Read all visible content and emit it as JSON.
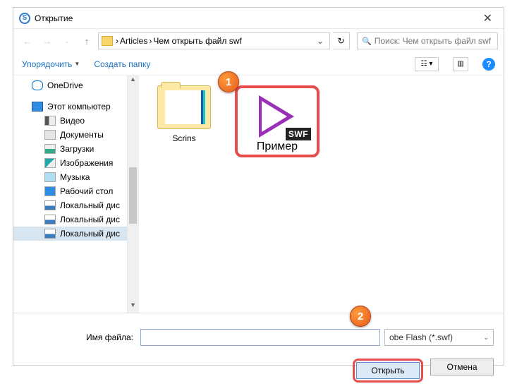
{
  "window": {
    "title": "Открытие",
    "close_glyph": "✕"
  },
  "nav": {
    "back_glyph": "←",
    "fwd_glyph": "→",
    "up_glyph": "↑",
    "crumb1": "Articles",
    "crumb2": "Чем открыть файл swf",
    "crumb_sep": "›",
    "drop_glyph": "⌄",
    "refresh_glyph": "↻",
    "search_placeholder": "Поиск: Чем открыть файл swf"
  },
  "toolbar": {
    "organize": "Упорядочить",
    "newfolder": "Создать папку",
    "help_glyph": "?"
  },
  "tree": {
    "onedrive": "OneDrive",
    "thispc": "Этот компьютер",
    "video": "Видео",
    "docs": "Документы",
    "downloads": "Загрузки",
    "images": "Изображения",
    "music": "Музыка",
    "desktop": "Рабочий стол",
    "disk1": "Локальный дис",
    "disk2": "Локальный дис",
    "disk3": "Локальный дис"
  },
  "files": {
    "folder1": "Scrins",
    "swf_label": "Пример",
    "swf_badge": "SWF"
  },
  "bottom": {
    "fname_label": "Имя файла:",
    "fname_value": "",
    "ftype": "obe Flash (*.swf)",
    "open": "Открыть",
    "cancel": "Отмена"
  },
  "callouts": {
    "c1": "1",
    "c2": "2"
  }
}
